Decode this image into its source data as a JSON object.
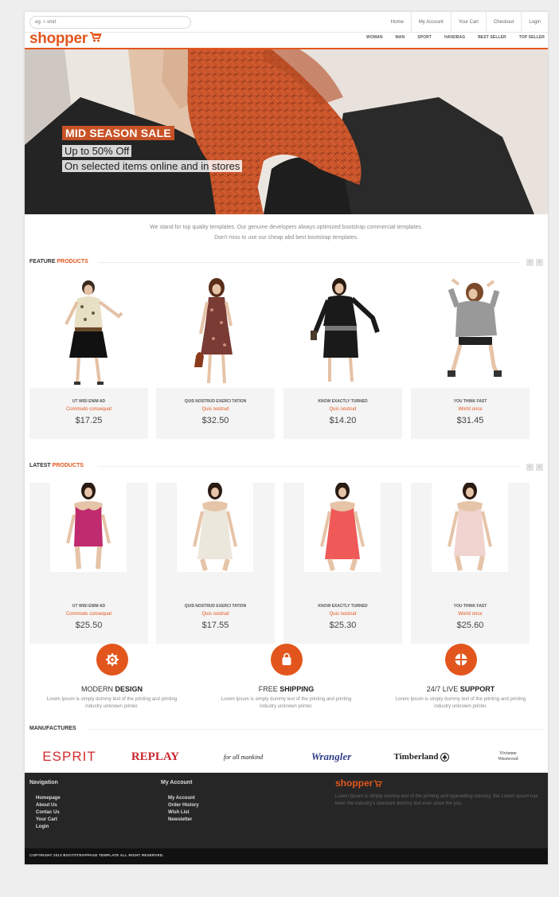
{
  "header": {
    "search_placeholder": "eg. T-shirt",
    "top_links": [
      "Home",
      "My Account",
      "Your Cart",
      "Checkout",
      "Login"
    ],
    "logo": "shopper",
    "nav": [
      "WOMAN",
      "MAN",
      "SPORT",
      "HANDBAG",
      "BEST SELLER",
      "TOP SELLER"
    ]
  },
  "hero": {
    "title": "MID SEASON SALE",
    "line1": "Up to 50% Off",
    "line2": "On selected items online and in stores"
  },
  "tagline": {
    "line1": "We stand for top quality templates. Our genuine developers always optimized bootstrap commercial templates.",
    "line2": "Don't miss to use our cheap abd best bootstrap templates."
  },
  "featured": {
    "title_plain": "FEATURE",
    "title_highlight": "PRODUCTS",
    "prev": "‹",
    "next": "›",
    "items": [
      {
        "name": "UT WISI ENIM AD",
        "sub": "Commodo consequat",
        "price": "$17.25"
      },
      {
        "name": "QUIS NOSTRUD EXERCI TATION",
        "sub": "Quis nostrud",
        "price": "$32.50"
      },
      {
        "name": "KNOW EXACTLY TURNED",
        "sub": "Quis nostrud",
        "price": "$14.20"
      },
      {
        "name": "YOU THINK FAST",
        "sub": "World once",
        "price": "$31.45"
      }
    ]
  },
  "latest": {
    "title_plain": "LATEST",
    "title_highlight": "PRODUCTS",
    "prev": "‹",
    "next": "›",
    "items": [
      {
        "name": "UT WISI ENIM AD",
        "sub": "Commodo consequat",
        "price": "$25.50"
      },
      {
        "name": "QUIS NOSTRUD EXERCI TATION",
        "sub": "Quis nostrud",
        "price": "$17.55"
      },
      {
        "name": "KNOW EXACTLY TURNED",
        "sub": "Quis nostrud",
        "price": "$25.30"
      },
      {
        "name": "YOU THINK FAST",
        "sub": "World once",
        "price": "$25.60"
      }
    ]
  },
  "features": [
    {
      "title_plain": "MODERN",
      "title_bold": "DESIGN",
      "desc": "Lorem Ipsum is simply dummy text of the printing and printing industry unknown printer.",
      "icon": "gear-icon"
    },
    {
      "title_plain": "FREE",
      "title_bold": "SHIPPING",
      "desc": "Lorem Ipsum is simply dummy text of the printing and printing industry unknown printer.",
      "icon": "bag-icon"
    },
    {
      "title_plain": "24/7 LIVE",
      "title_bold": "SUPPORT",
      "desc": "Lorem Ipsum is simply dummy text of the printing and printing industry unknown printer.",
      "icon": "lifebuoy-icon"
    }
  ],
  "manufactures": {
    "title": "MANUFACTURES",
    "brands": [
      "ESPRIT",
      "REPLAY",
      "for all mankind",
      "Wrangler",
      "Timberland",
      "Vivienne Westwood"
    ]
  },
  "footer": {
    "nav_title": "Navigation",
    "nav_items": [
      "Homepage",
      "About Us",
      "Contac Us",
      "Your Cart",
      "Login"
    ],
    "account_title": "My Account",
    "account_items": [
      "My Account",
      "Order History",
      "Wish List",
      "Newsletter"
    ],
    "logo": "shopper",
    "desc": "Lorem Ipsum is simply dummy text of the printing and typesetting industry. the Lorem Ipsum has been the industry's standard dummy text ever since the you.",
    "copyright": "COPYRIGHT 2013 BOOTSTRAPPAGE TEMPLATE ALL RIGHT RESERVED."
  },
  "colors": {
    "accent": "#e2561d",
    "footer_bg": "#262626"
  }
}
